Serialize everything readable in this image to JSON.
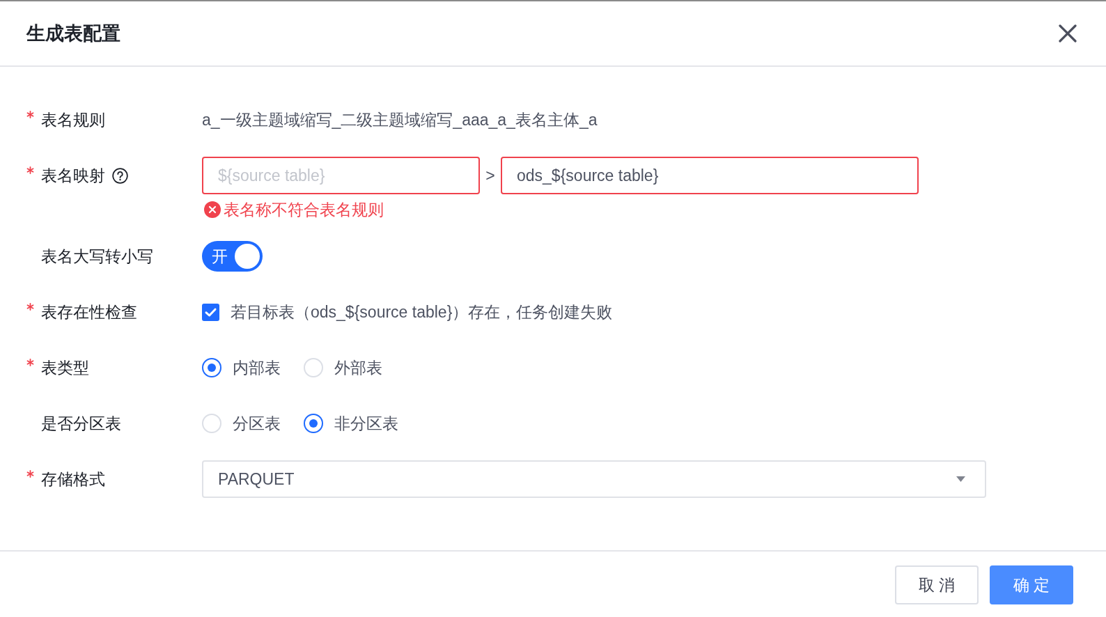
{
  "dialog": {
    "title": "生成表配置"
  },
  "form": {
    "rows": [
      {
        "kind": "text",
        "label": "表名规则",
        "required": true,
        "help": false,
        "value": "a_一级主题域缩写_二级主题域缩写_aaa_a_表名主体_a"
      },
      {
        "kind": "mapping",
        "label": "表名映射",
        "required": true,
        "help": true,
        "source": {
          "placeholder": "${source table}",
          "invalid": true
        },
        "separator": ">",
        "target": {
          "value": "ods_${source table}",
          "invalid": true
        },
        "error": "表名称不符合表名规则"
      },
      {
        "kind": "switch",
        "label": "表名大写转小写",
        "required": false,
        "help": false,
        "on": true,
        "text": "开"
      },
      {
        "kind": "checkbox",
        "label": "表存在性检查",
        "required": true,
        "help": false,
        "checked": true,
        "text": "若目标表（ods_${source table}）存在，任务创建失败"
      },
      {
        "kind": "radio",
        "label": "表类型",
        "required": true,
        "help": false,
        "options": [
          {
            "label": "内部表",
            "selected": true
          },
          {
            "label": "外部表",
            "selected": false
          }
        ]
      },
      {
        "kind": "radio",
        "label": "是否分区表",
        "required": false,
        "help": false,
        "options": [
          {
            "label": "分区表",
            "selected": false
          },
          {
            "label": "非分区表",
            "selected": true
          }
        ]
      },
      {
        "kind": "select",
        "label": "存储格式",
        "required": true,
        "help": false,
        "value": "PARQUET"
      }
    ]
  },
  "footer": {
    "buttons": [
      {
        "label": "取 消",
        "kind": "default"
      },
      {
        "label": "确 定",
        "kind": "primary"
      }
    ]
  }
}
